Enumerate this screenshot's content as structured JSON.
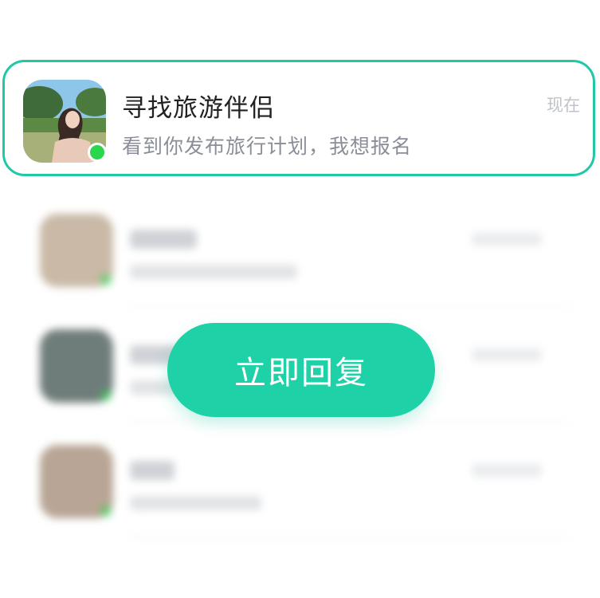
{
  "notification": {
    "title": "寻找旅游伴侣",
    "message": "看到你发布旅行计划，我想报名",
    "time": "现在"
  },
  "reply_button": {
    "label": "立即回复"
  },
  "colors": {
    "accent": "#1fd1a6",
    "card_border": "#21c8a6",
    "online": "#2ad64e"
  }
}
